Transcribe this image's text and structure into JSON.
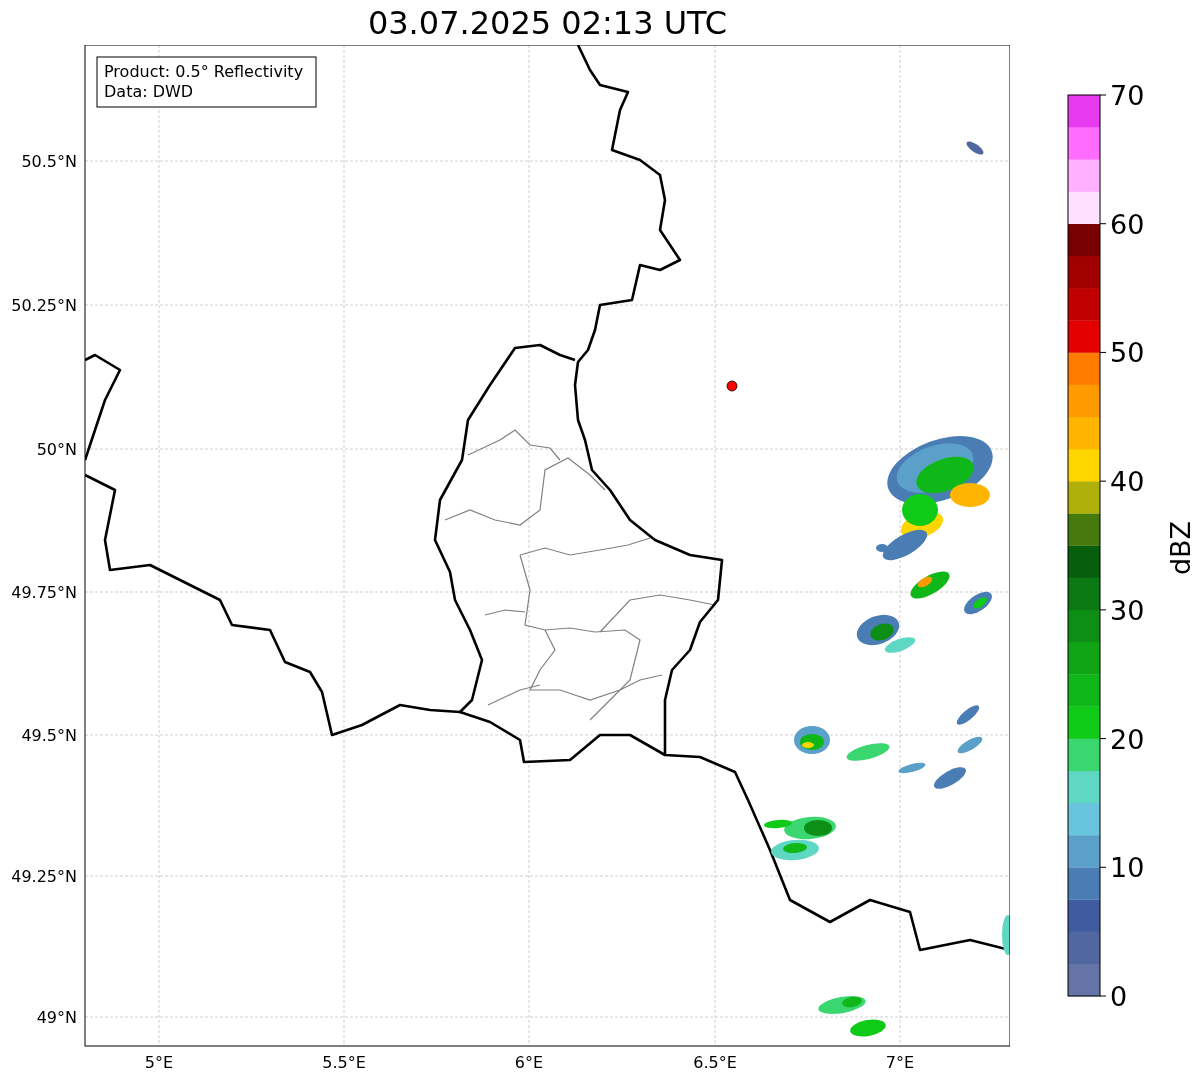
{
  "title": "03.07.2025 02:13 UTC",
  "legend": {
    "lines": [
      "Product: 0.5° Reflectivity",
      "Data: DWD"
    ]
  },
  "map": {
    "x_ticks": [
      "5°E",
      "5.5°E",
      "6°E",
      "6.5°E",
      "7°E"
    ],
    "y_ticks": [
      "50.5°N",
      "50.25°N",
      "50°N",
      "49.75°N",
      "49.5°N",
      "49.25°N",
      "49°N"
    ]
  },
  "colorbar": {
    "label": "dBZ",
    "ticks": [
      "70",
      "60",
      "50",
      "40",
      "30",
      "20",
      "10",
      "0"
    ],
    "bands": [
      {
        "color": "#6574a6"
      },
      {
        "color": "#51679f"
      },
      {
        "color": "#415ba0"
      },
      {
        "color": "#4b7db5"
      },
      {
        "color": "#5aa0c8"
      },
      {
        "color": "#67c4dc"
      },
      {
        "color": "#5ed7c3"
      },
      {
        "color": "#3ad66f"
      },
      {
        "color": "#0fca17"
      },
      {
        "color": "#0fb818"
      },
      {
        "color": "#0fa515"
      },
      {
        "color": "#0c8f14"
      },
      {
        "color": "#0b7a13"
      },
      {
        "color": "#075e0c"
      },
      {
        "color": "#467a0c"
      },
      {
        "color": "#b0b00a"
      },
      {
        "color": "#ffd500"
      },
      {
        "color": "#ffb400"
      },
      {
        "color": "#ff9a00"
      },
      {
        "color": "#ff7c00"
      },
      {
        "color": "#e50000"
      },
      {
        "color": "#c00000"
      },
      {
        "color": "#a00000"
      },
      {
        "color": "#780000"
      },
      {
        "color": "#ffe0ff"
      },
      {
        "color": "#ffb0ff"
      },
      {
        "color": "#ff6cff"
      },
      {
        "color": "#e83aee"
      }
    ]
  }
}
